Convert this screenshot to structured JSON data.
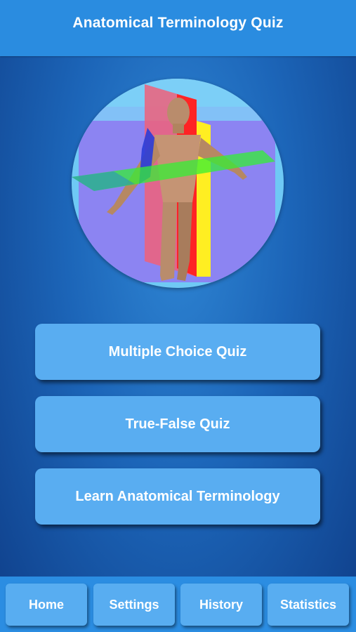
{
  "header": {
    "title": "Anatomical Terminology Quiz"
  },
  "hero": {
    "icon": "anatomical-planes-illustration"
  },
  "menu": {
    "multiple_choice": "Multiple Choice Quiz",
    "true_false": "True-False Quiz",
    "learn": "Learn Anatomical Terminology"
  },
  "tabs": {
    "home": "Home",
    "settings": "Settings",
    "history": "History",
    "statistics": "Statistics"
  },
  "colors": {
    "header": "#2a8ce0",
    "button": "#59adf1",
    "background": "#1c65b8"
  }
}
